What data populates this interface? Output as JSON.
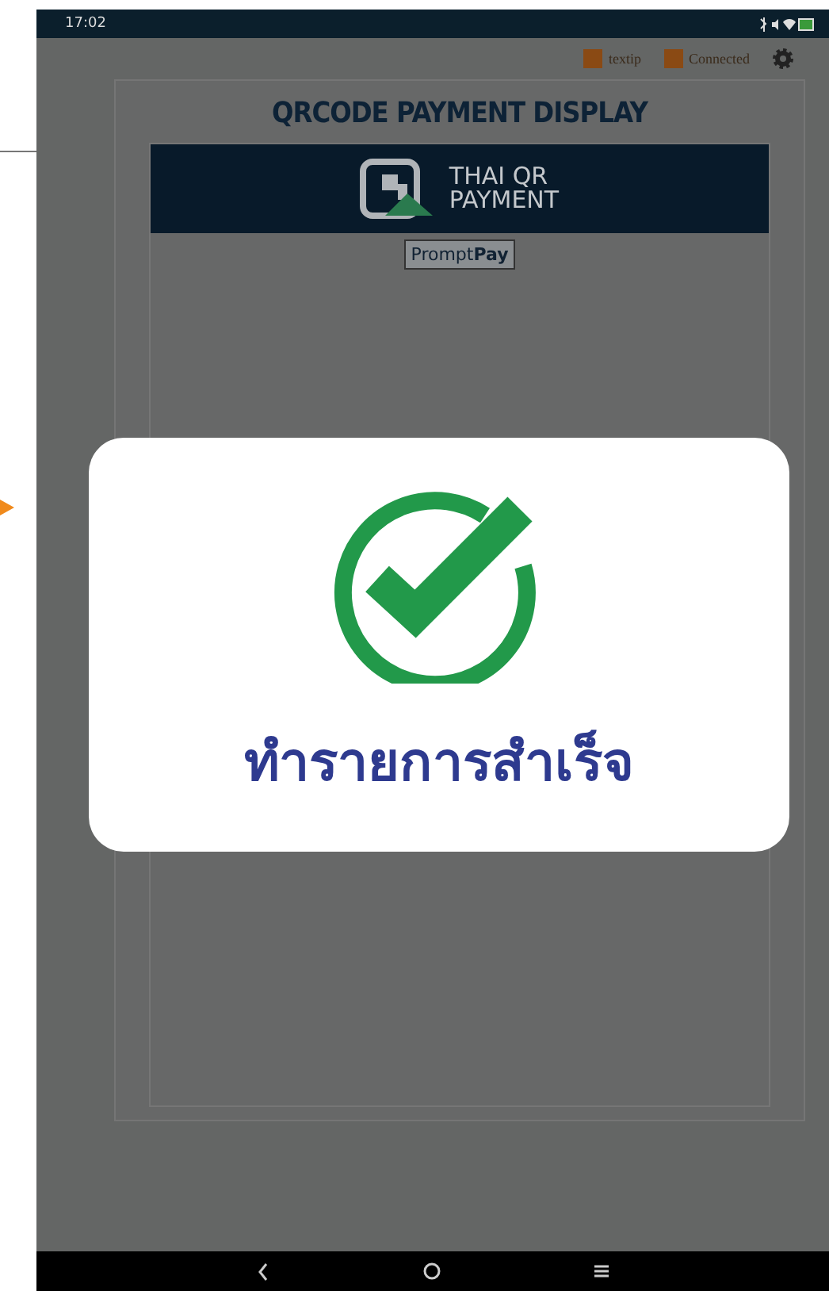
{
  "status_bar": {
    "time": "17:02"
  },
  "app_header": {
    "items": [
      {
        "label": "textip"
      },
      {
        "label": "Connected"
      }
    ]
  },
  "display": {
    "title": "QRCODE PAYMENT DISPLAY",
    "banner": {
      "line_1": "THAI QR",
      "line_2": "PAYMENT"
    },
    "badge": {
      "part_1": "Prompt",
      "part_2": "Pay"
    }
  },
  "dialog": {
    "message": "ทำรายการสำเร็จ"
  }
}
